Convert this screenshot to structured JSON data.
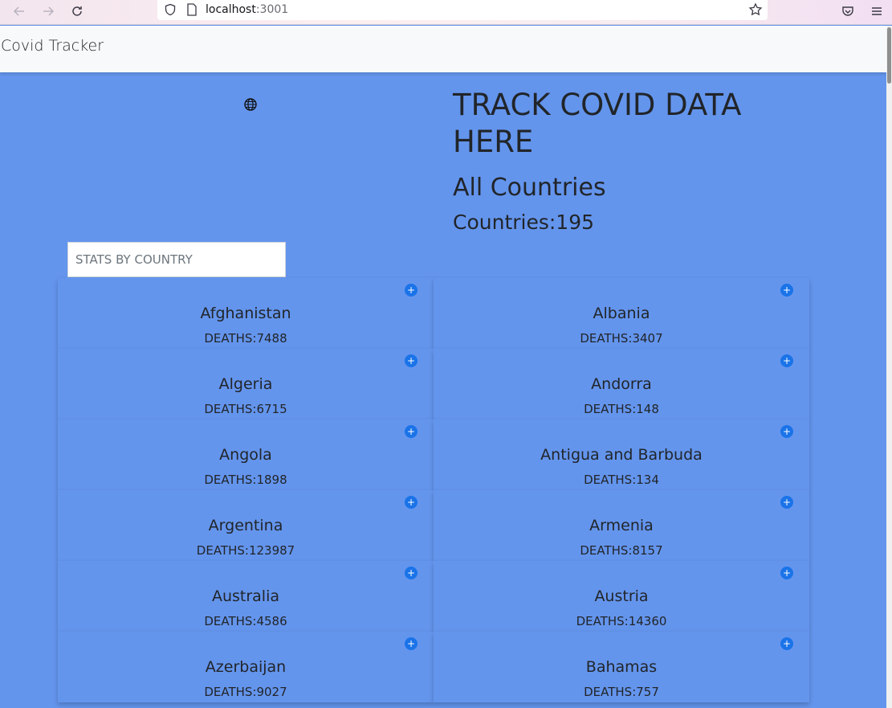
{
  "browser": {
    "url_host": "localhost",
    "url_port": ":3001",
    "icons": [
      "back-arrow-icon",
      "forward-arrow-icon",
      "reload-icon",
      "shield-icon",
      "page-icon",
      "star-icon",
      "pocket-icon",
      "menu-icon"
    ]
  },
  "navbar": {
    "brand": "Covid Tracker"
  },
  "hero": {
    "title": "TRACK COVID DATA HERE",
    "subtitle": "All Countries",
    "count": "Countries:195"
  },
  "search": {
    "placeholder": "STATS BY COUNTRY"
  },
  "countries": [
    {
      "name": "Afghanistan",
      "deaths": "DEATHS:7488"
    },
    {
      "name": "Albania",
      "deaths": "DEATHS:3407"
    },
    {
      "name": "Algeria",
      "deaths": "DEATHS:6715"
    },
    {
      "name": "Andorra",
      "deaths": "DEATHS:148"
    },
    {
      "name": "Angola",
      "deaths": "DEATHS:1898"
    },
    {
      "name": "Antigua and Barbuda",
      "deaths": "DEATHS:134"
    },
    {
      "name": "Argentina",
      "deaths": "DEATHS:123987"
    },
    {
      "name": "Armenia",
      "deaths": "DEATHS:8157"
    },
    {
      "name": "Australia",
      "deaths": "DEATHS:4586"
    },
    {
      "name": "Austria",
      "deaths": "DEATHS:14360"
    },
    {
      "name": "Azerbaijan",
      "deaths": "DEATHS:9027"
    },
    {
      "name": "Bahamas",
      "deaths": "DEATHS:757"
    }
  ],
  "colors": {
    "background": "#6495ED",
    "accent": "#1a73e8"
  }
}
